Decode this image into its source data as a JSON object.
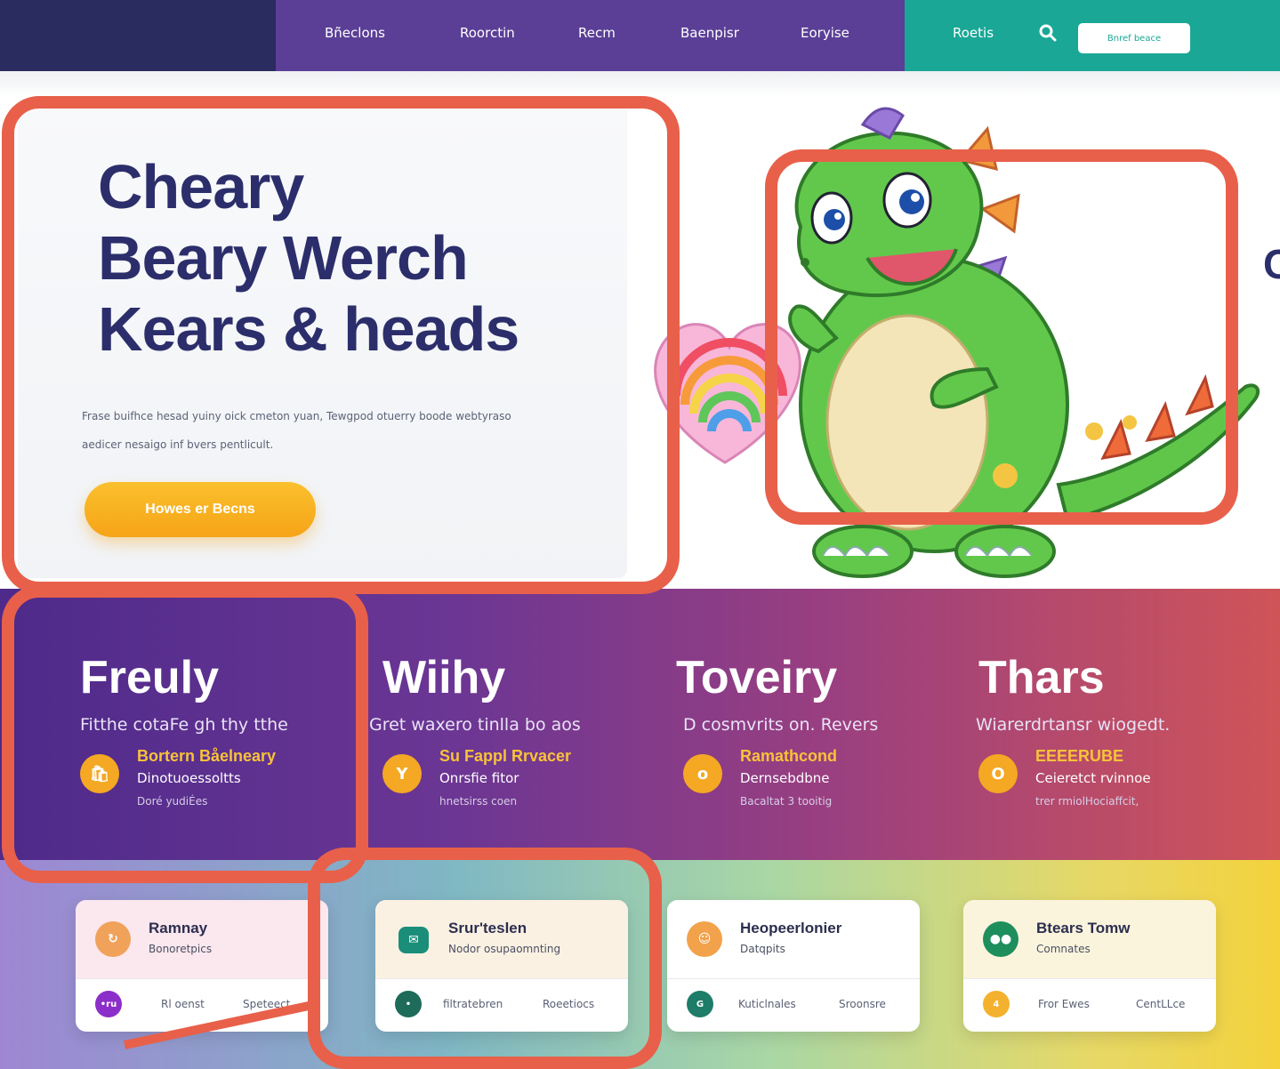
{
  "nav": {
    "links": [
      "Bñeclons",
      "Roorctin",
      "Recm",
      "Baenpisr",
      "Eoryise"
    ],
    "right_link": "Roetis",
    "cta": "Bnref beace"
  },
  "hero": {
    "title_lines": [
      "Cheary",
      "Beary Werch",
      "Kears & heads"
    ],
    "description": "Frase buifhce hesad yuiny oick cmeton yuan, Tewgpod otuerry boode webtyraso aedicer nesaigo inf bvers pentlicult.",
    "button": "Howes er Becns",
    "cut_letter": "C"
  },
  "features": [
    {
      "heading": "Freuly",
      "sub": "Fitthe cotaFe gh thy tthe",
      "item_name": "Bortern Båelneary",
      "item_line1": "Dinotuoessoltts",
      "item_line2": "Doré yudiÉes",
      "icon": "🛍"
    },
    {
      "heading": "Wiihy",
      "sub": "Gret waxero tinlla bo aos",
      "item_name": "Su Fappl Rrvacer",
      "item_line1": "Onrsfie fitor",
      "item_line2": "hnetsirss coen",
      "icon": "Y"
    },
    {
      "heading": "Toveiry",
      "sub": "D cosmvrits on. Revers",
      "item_name": "Ramathcond",
      "item_line1": "Dernsebdbne",
      "item_line2": "Bacaltat 3 tooitig",
      "icon": "o"
    },
    {
      "heading": "Thars",
      "sub": "Wiarerdrtansr wiogedt.",
      "item_name": "EEEERUBE",
      "item_line1": "Ceieretct rvinnoe",
      "item_line2": "trer rmiolHociaffcit,",
      "icon": "O"
    }
  ],
  "cards": [
    {
      "title": "Ramnay",
      "sub": "Bonoretpics",
      "link1": "Rl oenst",
      "link2": "Speteect",
      "icon_color": "#f0a25a",
      "bicon_text": "•ru",
      "bicon_color": "#8c2ec9",
      "top_bg": "#fbe7ee"
    },
    {
      "title": "Srur'teslen",
      "sub": "Nodor osupaomnting",
      "link1": "filtratebren",
      "link2": "Roeetiocs",
      "icon_color": "#1b8e7a",
      "bicon_text": "•",
      "bicon_color": "#1d6b58",
      "top_bg": "#fbf1e3"
    },
    {
      "title": "Heopeerlonier",
      "sub": "Datqpits",
      "link1": "Kuticlnales",
      "link2": "Sroonsre",
      "icon_color": "#f2a24a",
      "bicon_text": "G",
      "bicon_color": "#1d7d68",
      "top_bg": "#ffffff"
    },
    {
      "title": "Btears Tomw",
      "sub": "Comnates",
      "link1": "Fror Ewes",
      "link2": "CentLLce",
      "icon_color": "#1e8e5c",
      "bicon_text": "4",
      "bicon_color": "#f4b12e",
      "top_bg": "#fbf4dd"
    }
  ]
}
